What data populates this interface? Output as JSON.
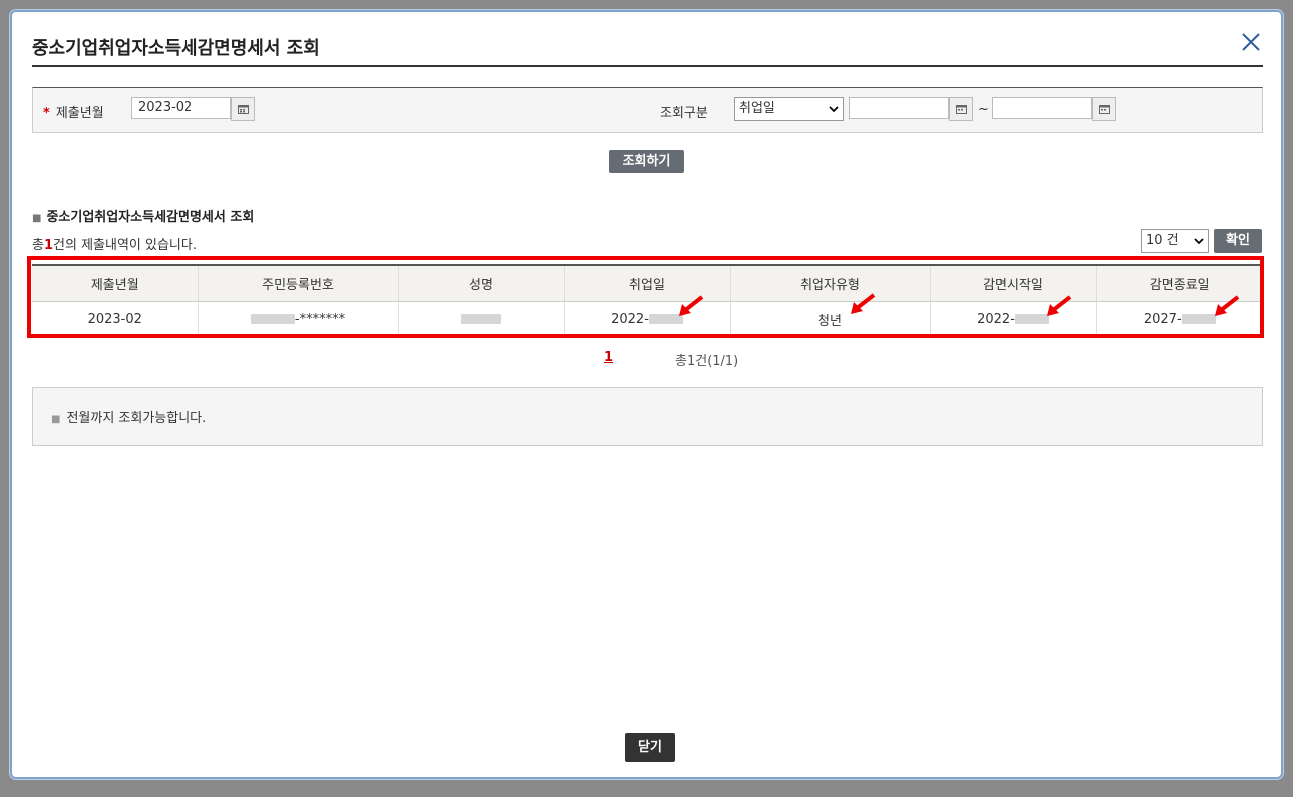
{
  "modal": {
    "title": "중소기업취업자소득세감면명세서 조회",
    "close_icon": "close-icon"
  },
  "search": {
    "year_month_label": "제출년월",
    "required_mark": "*",
    "year_month_value": "2023-02",
    "category_label": "조회구분",
    "category_selected": "취업일",
    "date_from": "",
    "date_to": "",
    "tilde": "~",
    "search_button": "조회하기"
  },
  "results": {
    "section_title": "중소기업취업자소득세감면명세서 조회",
    "count_prefix": "총",
    "count": "1",
    "count_suffix": "건의 제출내역이 있습니다.",
    "page_size": "10 건",
    "confirm_button": "확인",
    "columns": [
      "제출년월",
      "주민등록번호",
      "성명",
      "취업일",
      "취업자유형",
      "감면시작일",
      "감면종료일"
    ],
    "rows": [
      {
        "submit_month": "2023-02",
        "rrn_suffix": "-*******",
        "name": "",
        "employ_date_prefix": "2022-",
        "employee_type": "청년",
        "start_prefix": "2022-",
        "end_prefix": "2027-"
      }
    ]
  },
  "pager": {
    "current": "1",
    "summary": "총1건(1/1)"
  },
  "notice": {
    "text": "전월까지 조회가능합니다."
  },
  "footer": {
    "close_button": "닫기"
  },
  "colors": {
    "highlight": "#ee0000",
    "button_dark": "#666c73",
    "accent_red": "#cc0000",
    "modal_border": "#7fa4cc"
  }
}
